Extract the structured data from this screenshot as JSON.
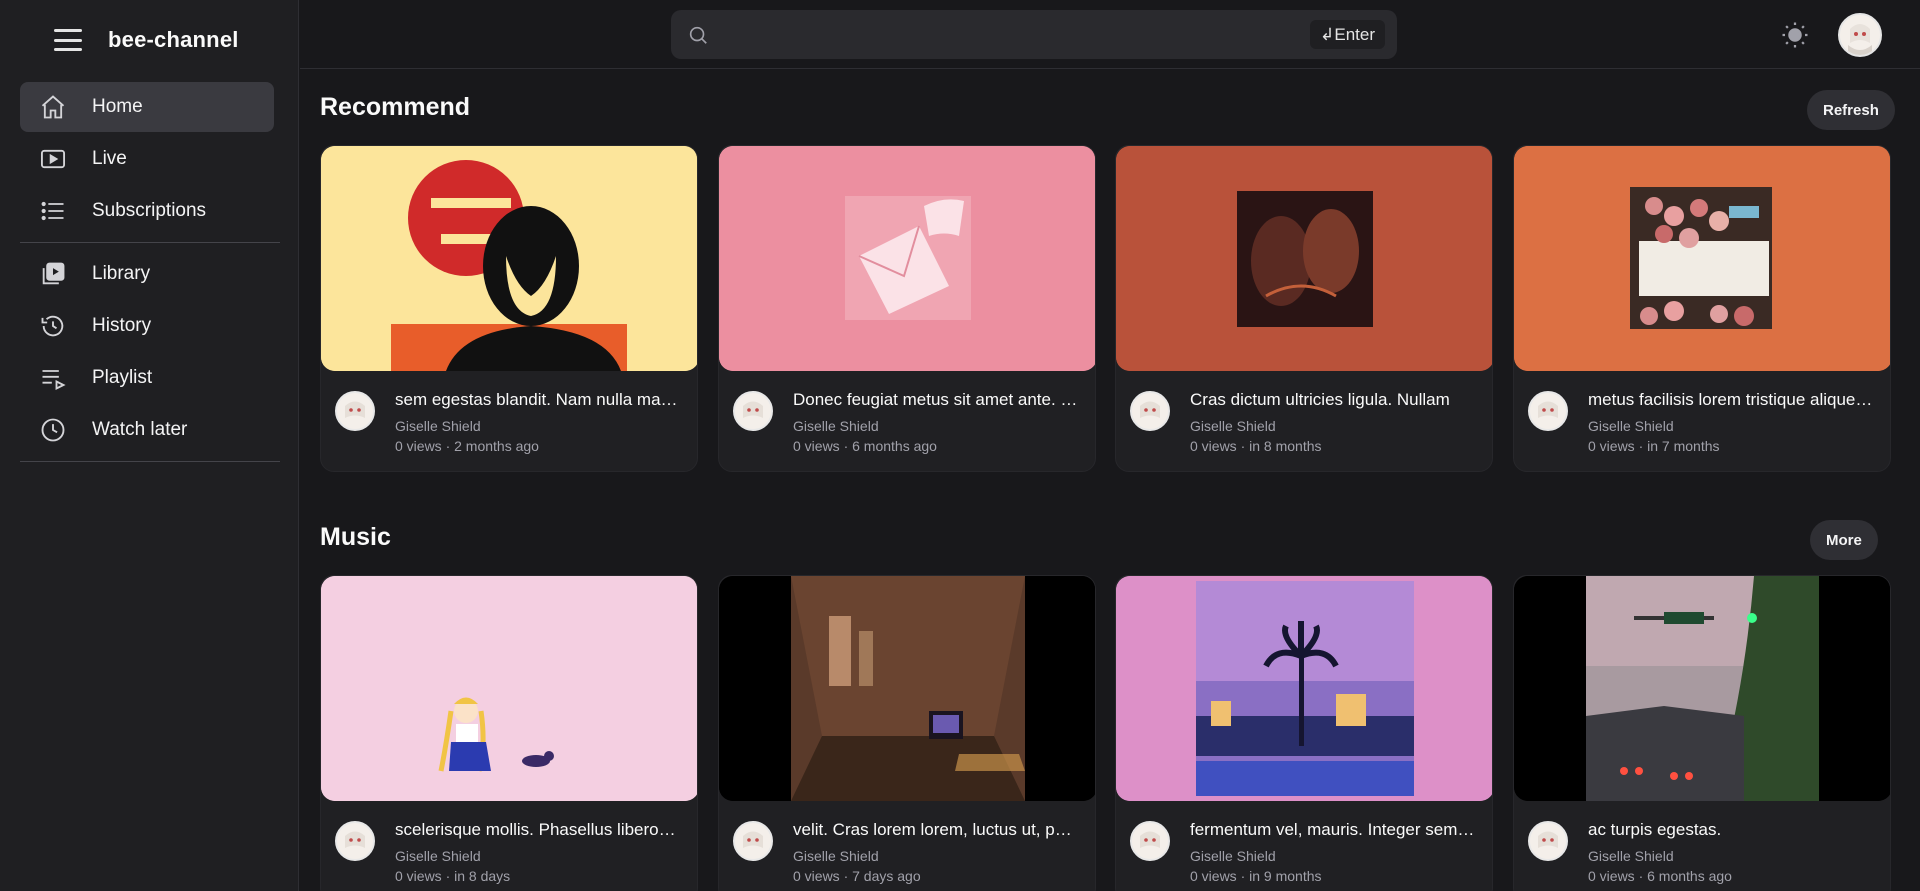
{
  "app": {
    "name": "bee-channel"
  },
  "sidebar": {
    "items": [
      {
        "label": "Home",
        "icon": "home-icon",
        "active": true
      },
      {
        "label": "Live",
        "icon": "live-icon"
      },
      {
        "label": "Subscriptions",
        "icon": "list-icon"
      },
      {
        "label": "Library",
        "icon": "library-icon"
      },
      {
        "label": "History",
        "icon": "history-icon"
      },
      {
        "label": "Playlist",
        "icon": "playlist-icon"
      },
      {
        "label": "Watch later",
        "icon": "clock-icon"
      }
    ]
  },
  "search": {
    "placeholder": "",
    "value": "",
    "enter_label": "↲Enter"
  },
  "sections": {
    "recommend": {
      "title": "Recommend",
      "button": "Refresh",
      "videos": [
        {
          "title": "sem egestas blandit. Nam nulla magna, malesuada vel",
          "channel": "Giselle Shield",
          "meta": "0 views · 2 months ago",
          "thumb_bg": "#fce59b"
        },
        {
          "title": "Donec feugiat metus sit amet ante. Vivamus non lorem",
          "channel": "Giselle Shield",
          "meta": "0 views · 6 months ago",
          "thumb_bg": "#ec8fa0"
        },
        {
          "title": "Cras dictum ultricies ligula. Nullam",
          "channel": "Giselle Shield",
          "meta": "0 views · in 8 months",
          "thumb_bg": "#b9523a"
        },
        {
          "title": "metus facilisis lorem tristique aliquet. Phasellus",
          "channel": "Giselle Shield",
          "meta": "0 views · in 7 months",
          "thumb_bg": "#dc7043"
        }
      ]
    },
    "music": {
      "title": "Music",
      "button": "More",
      "videos": [
        {
          "title": "scelerisque mollis. Phasellus libero mauris, aliquam",
          "channel": "Giselle Shield",
          "meta": "0 views · in 8 days",
          "thumb_bg": "#f4cfe1"
        },
        {
          "title": "velit. Cras lorem lorem, luctus ut, pellentesque",
          "channel": "Giselle Shield",
          "meta": "0 views · 7 days ago",
          "thumb_bg": "#000000"
        },
        {
          "title": "fermentum vel, mauris. Integer sem elit, pharetra",
          "channel": "Giselle Shield",
          "meta": "0 views · in 9 months",
          "thumb_bg": "#dd90c8"
        },
        {
          "title": "ac turpis egestas.",
          "channel": "Giselle Shield",
          "meta": "0 views · 6 months ago",
          "thumb_bg": "#000000"
        }
      ]
    }
  }
}
